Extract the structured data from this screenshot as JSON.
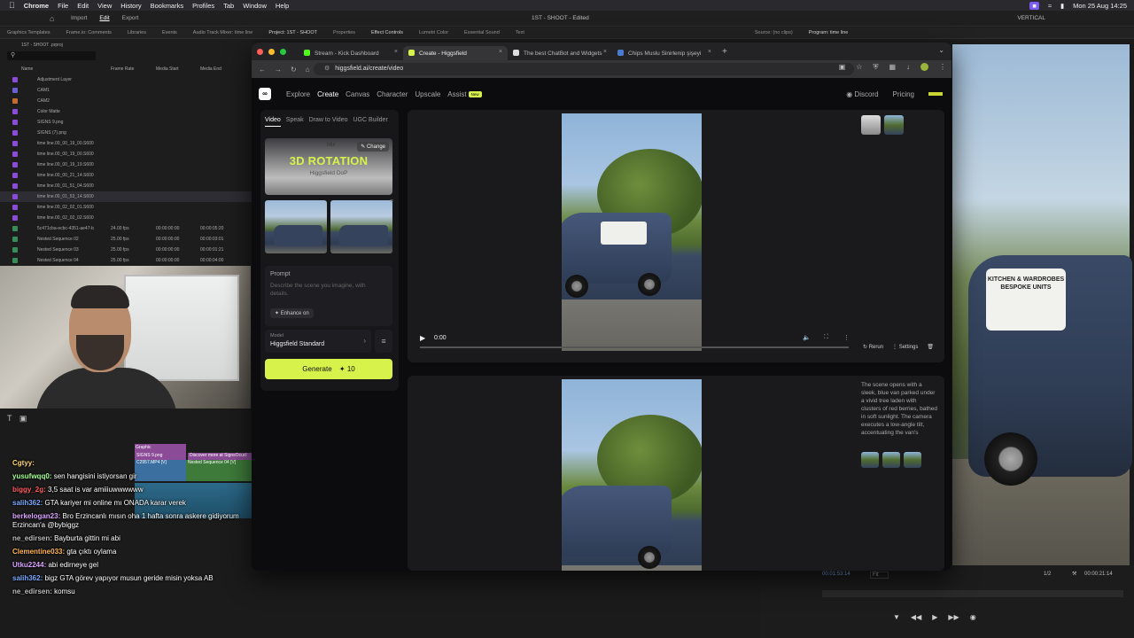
{
  "menubar": {
    "app": "Chrome",
    "items": [
      "File",
      "Edit",
      "View",
      "History",
      "Bookmarks",
      "Profiles",
      "Tab",
      "Window",
      "Help"
    ],
    "layout_label": "VERTICAL",
    "clock": "Mon 25 Aug  14:25"
  },
  "premiere": {
    "top_tabs": [
      "Import",
      "Edit",
      "Export"
    ],
    "title": "1ST - SHOOT - Edited",
    "panel_tabs": [
      "Graphics Templates",
      "Frame.io: Comments",
      "Libraries",
      "Events",
      "Audio Track Mixer: time line",
      "Project: 1ST - SHOOT",
      "Properties",
      "Effect Controls",
      "Lumetri Color",
      "Essential Sound",
      "Text",
      "Source: (no clips)",
      "Program: time line"
    ],
    "project_file": "1ST - SHOOT .prproj",
    "columns": [
      "Name",
      "Frame Rate",
      "Media Start",
      "Media End"
    ],
    "items": [
      {
        "name": "Adjustment Layer",
        "color": "#8a4bd6",
        "fr": "",
        "ms": "",
        "me": ""
      },
      {
        "name": "CAM1",
        "color": "#6a5fd0",
        "fr": "",
        "ms": "",
        "me": ""
      },
      {
        "name": "CAM2",
        "color": "#c56a2e",
        "fr": "",
        "ms": "",
        "me": ""
      },
      {
        "name": "Color Matte",
        "color": "#8a4bd6",
        "fr": "",
        "ms": "",
        "me": ""
      },
      {
        "name": "SIGNS 9.png",
        "color": "#8a4bd6",
        "fr": "",
        "ms": "",
        "me": ""
      },
      {
        "name": "SIGNS (7).png",
        "color": "#8a4bd6",
        "fr": "",
        "ms": "",
        "me": ""
      },
      {
        "name": "time line.00_00_19_00.S600",
        "color": "#8a4bd6",
        "fr": "",
        "ms": "",
        "me": ""
      },
      {
        "name": "time line.00_00_19_00.S600",
        "color": "#8a4bd6",
        "fr": "",
        "ms": "",
        "me": ""
      },
      {
        "name": "time line.00_00_19_19.S600",
        "color": "#8a4bd6",
        "fr": "",
        "ms": "",
        "me": ""
      },
      {
        "name": "time line.00_00_21_14.S600",
        "color": "#8a4bd6",
        "fr": "",
        "ms": "",
        "me": ""
      },
      {
        "name": "time line.00_01_51_04.S600",
        "color": "#8a4bd6",
        "fr": "",
        "ms": "",
        "me": ""
      },
      {
        "name": "time line.00_01_53_14.S600",
        "color": "#8a4bd6",
        "fr": "",
        "ms": "",
        "me": ""
      },
      {
        "name": "time line.00_02_02_01.S600",
        "color": "#8a4bd6",
        "fr": "",
        "ms": "",
        "me": ""
      },
      {
        "name": "time line.00_02_02_02.S600",
        "color": "#8a4bd6",
        "fr": "",
        "ms": "",
        "me": ""
      },
      {
        "name": "5c471cba-ecbc-4351-ae47-b",
        "color": "#3a8a5a",
        "fr": "24.00 fps",
        "ms": "00:00:00:00",
        "me": "00:00:05:20"
      },
      {
        "name": "Nested Sequence 02",
        "color": "#3a8a5a",
        "fr": "25.00 fps",
        "ms": "00:00:00:00",
        "me": "00:00:03:01"
      },
      {
        "name": "Nested Sequence 03",
        "color": "#3a8a5a",
        "fr": "25.00 fps",
        "ms": "00:00:00:00",
        "me": "00:00:01:21"
      },
      {
        "name": "Nested Sequence 04",
        "color": "#3a8a5a",
        "fr": "25.00 fps",
        "ms": "00:00:00:00",
        "me": "00:00:04:00"
      }
    ],
    "timeline_clips": [
      "Graphic",
      "SIGNS 9.png",
      "fx",
      "Discover more at SignsOcucl",
      "C2957.MP4 [V]",
      "fx",
      "Nested Sequence 04 [V]"
    ],
    "timecode_left": "00:01:53:14",
    "zoom": "Fit",
    "fraction": "1/2",
    "timecode_right": "00:00:21:14"
  },
  "chat": [
    {
      "user": "Cgtyy:",
      "color": "#ffd86b",
      "text": ""
    },
    {
      "user": "yusufwqq0:",
      "color": "#a3ff8f",
      "text": "sen hangisini istiyorsan gir"
    },
    {
      "user": "biggy_2g:",
      "color": "#ff5c5c",
      "text": "3,5 saat is var amiiiuwwwwww"
    },
    {
      "user": "salih362:",
      "color": "#7aa8ff",
      "text": "GTA kariyer mi online mı ONADA karar verek"
    },
    {
      "user": "berkelogan23:",
      "color": "#d9a3ff",
      "text": "Bro Erzincanlı mısın oha 1 hafta sonra askere gidiyorum Erzincan'a @bybiggz"
    },
    {
      "user": "ne_edirsen:",
      "color": "#bbbbbb",
      "text": "Bayburta gittin mi abi"
    },
    {
      "user": "Clementine033:",
      "color": "#ffb84d",
      "text": "gta çıktı oylama"
    },
    {
      "user": "Utku2244:",
      "color": "#d9a3ff",
      "text": "abi edirneye gel"
    },
    {
      "user": "salih362:",
      "color": "#7aa8ff",
      "text": "bigz GTA görev yapıyor musun geride misin yoksa AB"
    },
    {
      "user": "ne_edirsen:",
      "color": "#bbbbbb",
      "text": "komsu"
    }
  ],
  "browser": {
    "tabs": [
      {
        "title": "Stream - Kick Dashboard",
        "fav": "#53fc18"
      },
      {
        "title": "Create - Higgsfield",
        "fav": "#d7f24a"
      },
      {
        "title": "The best ChatBot and Widgets",
        "fav": "#dddddd"
      },
      {
        "title": "Chips Muslu Sinirlenip şişeyi",
        "fav": "#4a7bd0"
      }
    ],
    "url": "higgsfield.ai/create/video"
  },
  "higgsfield": {
    "nav": [
      "Explore",
      "Create",
      "Canvas",
      "Character",
      "Upscale",
      "Assist"
    ],
    "assist_badge": "New",
    "discord": "Discord",
    "pricing": "Pricing",
    "side_tabs": [
      "Video",
      "Speak",
      "Draw to Video",
      "UGC Builder"
    ],
    "effect_title": "3D ROTATION",
    "effect_sub": "Higgsfield DoP",
    "mix_label": "Mix",
    "change_label": "Change",
    "prompt_label": "Prompt",
    "prompt_placeholder": "Describe the scene you imagine, with details.",
    "enhance_label": "Enhance on",
    "model_label": "Model",
    "model_value": "Higgsfield Standard",
    "generate_label": "Generate",
    "generate_cost": "10",
    "player_time": "0:00",
    "rerun": "Rerun",
    "settings": "Settings",
    "description": "The scene opens with a sleek, blue van parked under a vivid tree laden with clusters of red berries, bathed in soft sunlight. The camera executes a low-angle tilt, accentuating the van's"
  },
  "program_monitor": {
    "decal_text": "KITCHEN & WARDROBES BESPOKE UNITS"
  }
}
